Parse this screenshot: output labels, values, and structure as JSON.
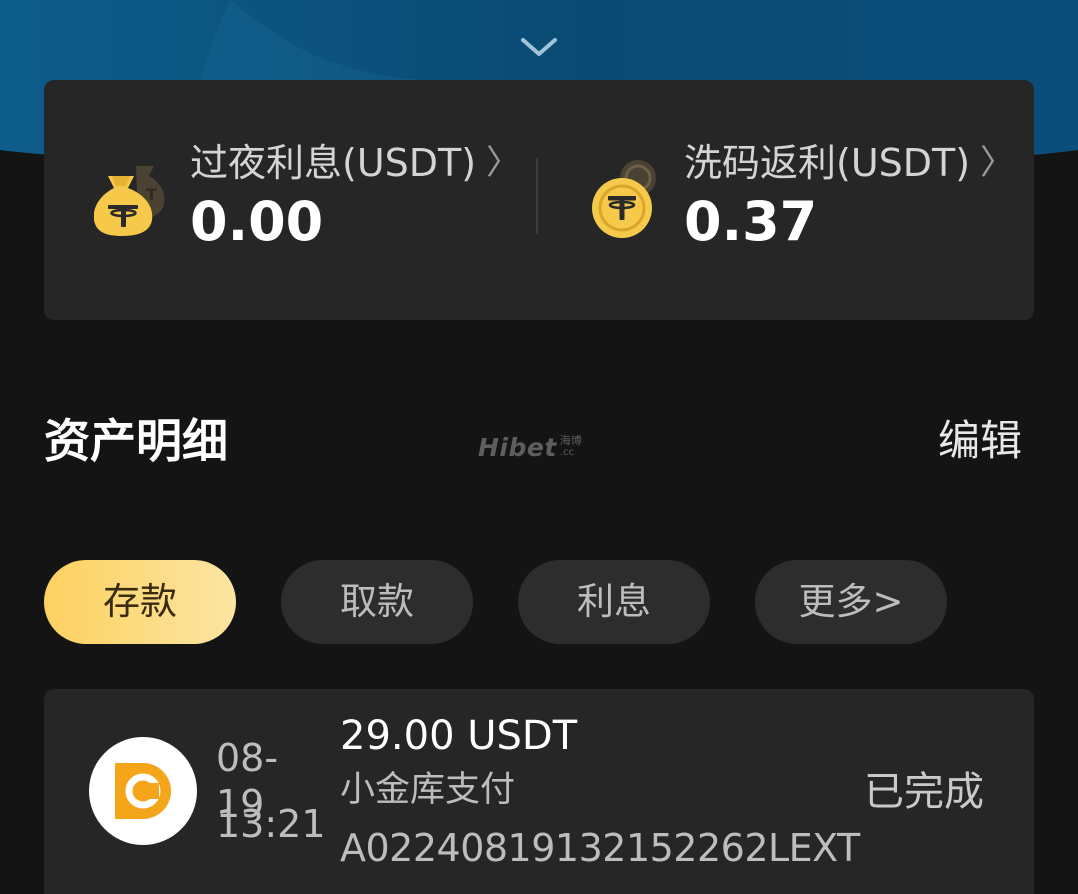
{
  "summary": {
    "overnight": {
      "label": "过夜利息(USDT)",
      "arrow": "〉",
      "value": "0.00",
      "icon": "money-bag-usdt-icon"
    },
    "rebate": {
      "label": "洗码返利(USDT)",
      "arrow": "〉",
      "value": "0.37",
      "icon": "usdt-coin-icon"
    }
  },
  "section": {
    "title": "资产明细",
    "edit_label": "编辑",
    "watermark": {
      "main": "Hibet",
      "cn": "海博",
      "suffix": ".cc"
    }
  },
  "tabs": [
    {
      "label": "存款",
      "active": true
    },
    {
      "label": "取款",
      "active": false
    },
    {
      "label": "利息",
      "active": false
    },
    {
      "label": "更多>",
      "active": false
    }
  ],
  "records": [
    {
      "date": "08-19",
      "time": "13:21",
      "amount": "29.00 USDT",
      "method": "小金库支付",
      "order_id": "A02240819132152262LEXT",
      "status": "已完成",
      "icon": "wallet-c-logo-icon"
    }
  ],
  "colors": {
    "accent_gold": "#fdd15f",
    "card_bg": "#262626",
    "page_bg": "#141414",
    "header_blue": "#0e5a86"
  }
}
